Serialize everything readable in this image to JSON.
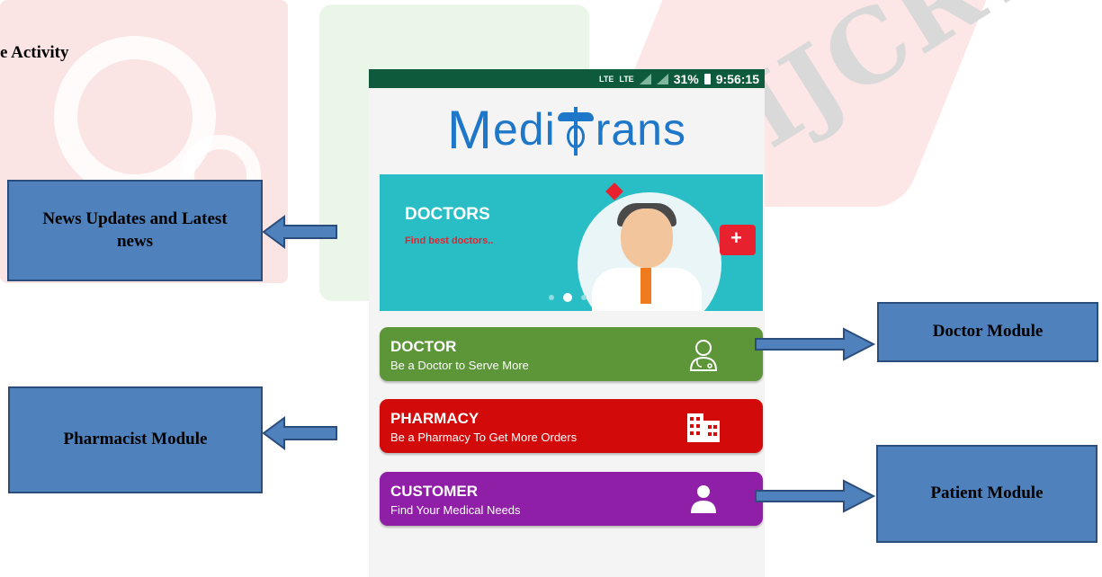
{
  "page_label": "e Activity",
  "watermark": "IJCRT",
  "status_bar": {
    "lte1": "LTE",
    "lte2": "LTE",
    "battery": "31%",
    "time": "9:56:15"
  },
  "app": {
    "logo_first": "M",
    "logo_mid": "edi",
    "logo_last": "rans"
  },
  "banner": {
    "title": "DOCTORS",
    "subtitle": "Find best doctors..",
    "active_slide": 2,
    "slide_count": 3
  },
  "modules": [
    {
      "title": "DOCTOR",
      "subtitle": "Be a Doctor to Serve More",
      "color": "#5c9638",
      "icon": "doctor-icon"
    },
    {
      "title": "PHARMACY",
      "subtitle": "Be a Pharmacy To Get More Orders",
      "color": "#d20a0a",
      "icon": "building-icon"
    },
    {
      "title": "CUSTOMER",
      "subtitle": "Find Your Medical Needs",
      "color": "#8f1fa6",
      "icon": "user-icon"
    }
  ],
  "callouts": {
    "news": "News Updates and Latest news",
    "pharmacist": "Pharmacist Module",
    "doctor": "Doctor Module",
    "patient": "Patient Module"
  },
  "colors": {
    "callout": "#4f81bd",
    "status_bar": "#0d5b3c",
    "logo": "#1e77c8",
    "banner": "#29bec6"
  }
}
